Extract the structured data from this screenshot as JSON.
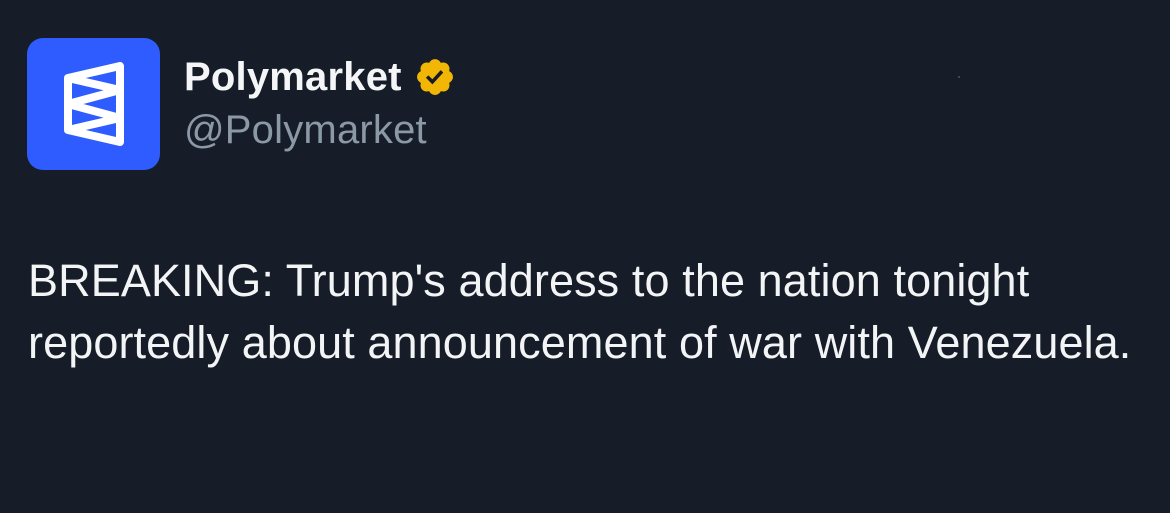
{
  "author": {
    "display_name": "Polymarket",
    "handle": "@Polymarket",
    "verified": true,
    "verified_badge_color": "#f2b705",
    "avatar_bg_color": "#2e5cff"
  },
  "tweet": {
    "text": "BREAKING: Trump's address to the nation tonight reportedly about announcement of war with Venezuela."
  },
  "theme": {
    "background": "#161d28",
    "text_color": "#e7e9ea",
    "handle_color": "#8b98a5"
  }
}
